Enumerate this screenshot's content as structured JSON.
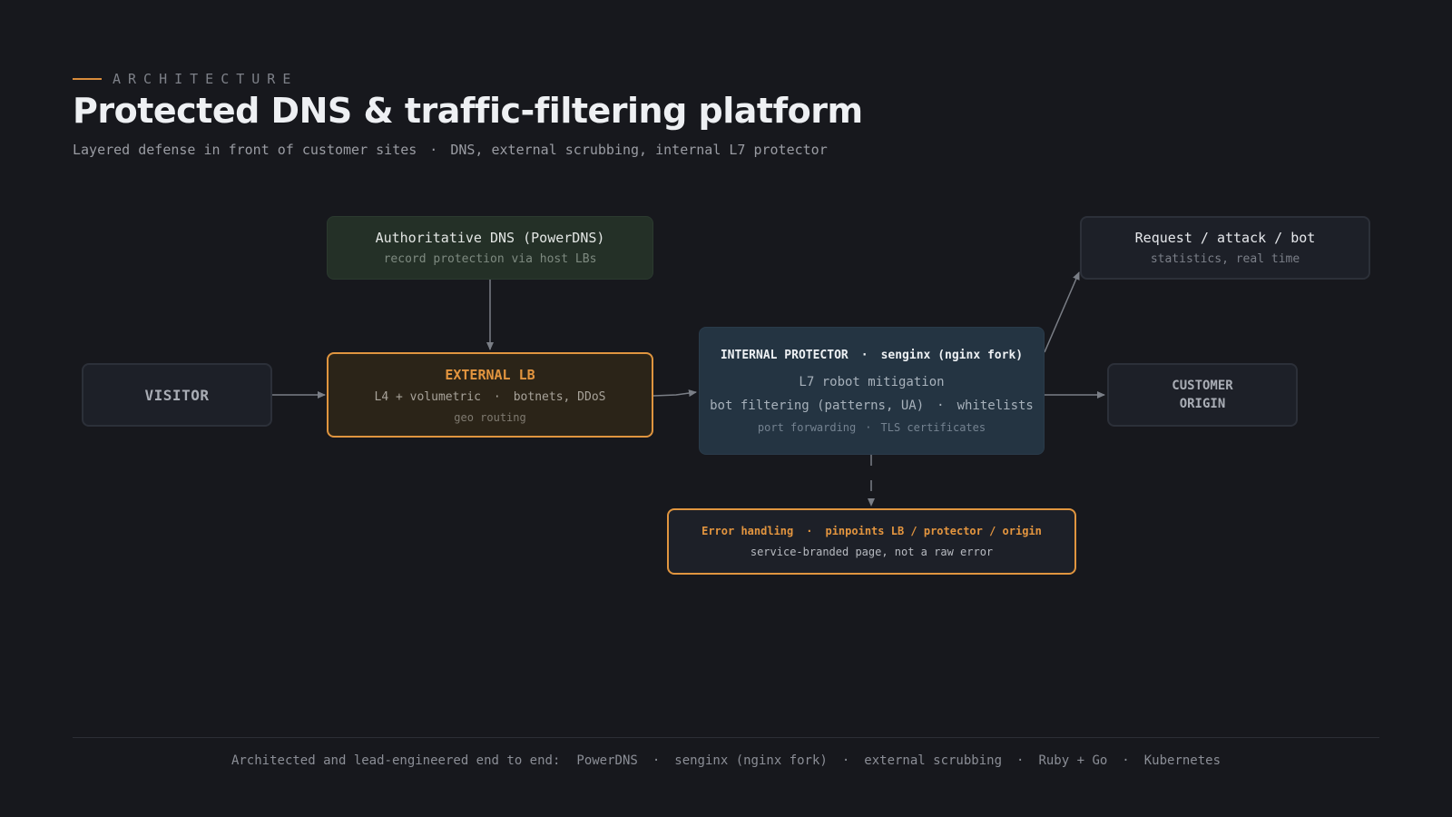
{
  "header": {
    "eyebrow": "ARCHITECTURE",
    "title": "Protected DNS & traffic-filtering platform",
    "subtitle_left": "Layered defense in front of customer sites",
    "subtitle_sep": "·",
    "subtitle_right": "DNS, external scrubbing, internal L7 protector"
  },
  "nodes": {
    "dns": {
      "title": "Authoritative DNS (PowerDNS)",
      "detail": "record protection via host LBs"
    },
    "stats": {
      "title": "Request / attack / bot",
      "detail": "statistics, real time"
    },
    "visitor": {
      "title": "VISITOR"
    },
    "external_lb": {
      "title": "EXTERNAL LB",
      "detail_a": "L4 + volumetric",
      "detail_b": "botnets, DDoS",
      "detail_c": "geo routing"
    },
    "internal": {
      "title_a": "INTERNAL PROTECTOR",
      "title_b": "senginx (nginx fork)",
      "line1": "L7 robot mitigation",
      "line2_a": "bot filtering (patterns, UA)",
      "line2_b": "whitelists",
      "line3_a": "port forwarding",
      "line3_b": "TLS certificates"
    },
    "origin": {
      "title": "CUSTOMER ORIGIN"
    },
    "error": {
      "title_a": "Error handling",
      "title_b": "pinpoints LB / protector / origin",
      "detail": "service-branded page, not a raw error"
    }
  },
  "separator": "·",
  "footer": {
    "lead": "Architected and lead-engineered end to end:",
    "items": [
      "PowerDNS",
      "senginx (nginx fork)",
      "external scrubbing",
      "Ruby + Go",
      "Kubernetes"
    ]
  },
  "colors": {
    "background": "#17181d",
    "accent": "#e0953f",
    "dns_fill": "#243027",
    "protector_fill": "#243442",
    "arrow": "#7a7e86"
  }
}
